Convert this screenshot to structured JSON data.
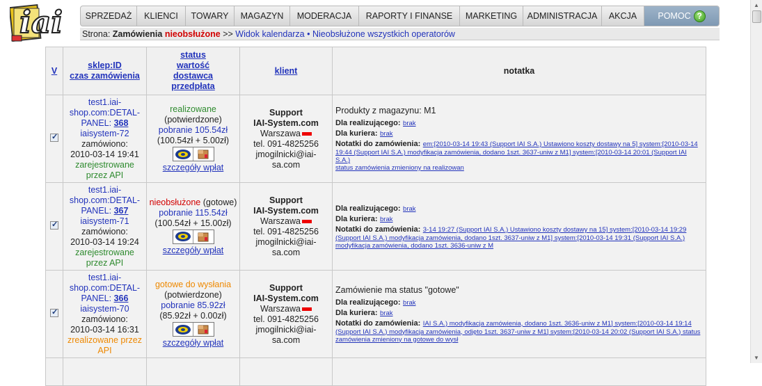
{
  "logo": {
    "text": "iai"
  },
  "nav": {
    "items": [
      "SPRZEDAŻ",
      "KLIENCI",
      "TOWARY",
      "MAGAZYN",
      "MODERACJA",
      "RAPORTY I FINANSE",
      "MARKETING",
      "ADMINISTRACJA",
      "AKCJA"
    ],
    "help": "POMOC",
    "help_icon": "?"
  },
  "breadcrumb": {
    "prefix": "Strona:",
    "page": "Zamówienia",
    "status": "nieobsłużone",
    "sep": ">>",
    "link1": "Widok kalendarza",
    "dot": "•",
    "link2": "Nieobsłużone wszystkich operatorów"
  },
  "table": {
    "headers": {
      "v": "V",
      "shop_l1": "sklep:ID",
      "shop_l2": "czas zamówienia",
      "status_l1": "status",
      "status_l2": "wartość",
      "status_l3": "dostawca",
      "status_l4": "przedpłata",
      "client": "klient",
      "note": "notatka"
    },
    "rows": [
      {
        "shop_a": "test1.iai-",
        "shop_b": "shop.com:DETAL-",
        "shop_c": "PANEL:",
        "id": "368",
        "system": "iaisystem-72",
        "ordered_label": "zamówiono:",
        "date": "2010-03-14 19:41",
        "reg_a": "zarejestrowane",
        "reg_b": "przez API",
        "status": "realizowane",
        "status_extra": "(potwierdzone)",
        "payment": "pobranie 105.54zł",
        "value": "(100.54zł + 5.00zł)",
        "details": "szczegóły wpłat",
        "client_a": "Support",
        "client_b": "IAI-System.com",
        "city": "Warszawa",
        "phone": "tel. 091-4825256",
        "email_a": "jmogilnicki@iai-",
        "email_b": "sa.com",
        "note_plain": "Produkty z magazynu: M1",
        "realizer_label": "Dla realizującego:",
        "realizer_val": "brak",
        "courier_label": "Dla kuriera:",
        "courier_val": "brak",
        "notes_label": "Notatki do zamówienia:",
        "notes_1": "em:[2010-03-14 19:43 (Support IAI S.A.) Ustawiono koszty dostawy na 5] system:[2010-03-14",
        "notes_2": "19:44 (Support IAI S.A.) modyfikacja zamówienia, dodano 1szt. 3637-uniw z M1] system:[2010-03-14 20:01 (Support IAI S.A.)",
        "notes_3": "status zamówienia zmieniony na realizowan"
      },
      {
        "shop_a": "test1.iai-",
        "shop_b": "shop.com:DETAL-",
        "shop_c": "PANEL:",
        "id": "367",
        "system": "iaisystem-71",
        "ordered_label": "zamówiono:",
        "date": "2010-03-14 19:24",
        "reg_a": "zarejestrowane",
        "reg_b": "przez API",
        "status": "nieobsłużone",
        "status_extra": "(gotowe)",
        "payment": "pobranie 115.54zł",
        "value": "(100.54zł + 15.00zł)",
        "details": "szczegóły wpłat",
        "client_a": "Support",
        "client_b": "IAI-System.com",
        "city": "Warszawa",
        "phone": "tel. 091-4825256",
        "email_a": "jmogilnicki@iai-",
        "email_b": "sa.com",
        "note_plain": "",
        "realizer_label": "Dla realizującego:",
        "realizer_val": "brak",
        "courier_label": "Dla kuriera:",
        "courier_val": "brak",
        "notes_label": "Notatki do zamówienia:",
        "notes_1": "3-14 19:27 (Support IAI S.A.) Ustawiono koszty dostawy na 15] system:[2010-03-14 19:29",
        "notes_2": "(Support IAI S.A.) modyfikacja zamówienia, dodano 1szt. 3637-uniw z M1] system:[2010-03-14 19:31 (Support IAI S.A.)",
        "notes_3": "modyfikacja zamówienia, dodano 1szt. 3636-uniw z M"
      },
      {
        "shop_a": "test1.iai-",
        "shop_b": "shop.com:DETAL-",
        "shop_c": "PANEL:",
        "id": "366",
        "system": "iaisystem-70",
        "ordered_label": "zamówiono:",
        "date": "2010-03-14 16:31",
        "reg_a": "zrealizowane przez",
        "reg_b": "API",
        "status": "gotowe do wysłania",
        "status_extra": "(potwierdzone)",
        "payment": "pobranie 85.92zł",
        "value": "(85.92zł + 0.00zł)",
        "details": "szczegóły wpłat",
        "client_a": "Support",
        "client_b": "IAI-System.com",
        "city": "Warszawa",
        "phone": "tel. 091-4825256",
        "email_a": "jmogilnicki@iai-",
        "email_b": "sa.com",
        "note_plain": "Zamówienie ma status \"gotowe\"",
        "realizer_label": "Dla realizującego:",
        "realizer_val": "brak",
        "courier_label": "Dla kuriera:",
        "courier_val": "brak",
        "notes_label": "Notatki do zamówienia:",
        "notes_1": "IAI S.A.) modyfikacja zamówienia, dodano 1szt. 3636-uniw z M1] system:[2010-03-14 19:14",
        "notes_2": "(Support IAI S.A.) modyfikacja zamówienia, odjęto 1szt. 3637-uniw z M1] system:[2010-03-14 20:02 (Support IAI S.A.) status",
        "notes_3": "zamówienia zmieniony na gotowe do wysł"
      }
    ]
  },
  "colors": {
    "link": "#2233bb",
    "status_green": "#2e8a2e",
    "status_red": "#d20000",
    "status_orange": "#ee8800",
    "nav_help_bg": "#8ea6be"
  }
}
